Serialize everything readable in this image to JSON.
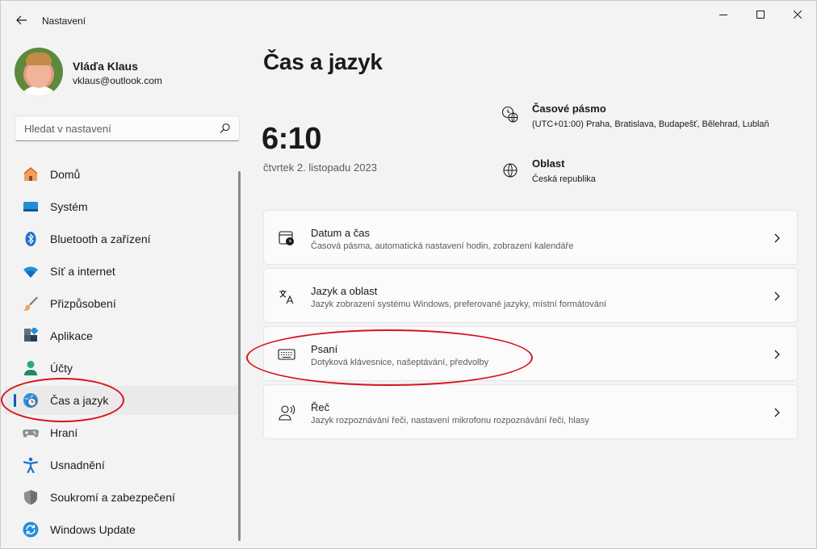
{
  "window": {
    "title": "Nastavení",
    "icons": {
      "back": "back-arrow-icon",
      "minimize": "minimize-icon",
      "maximize": "maximize-icon",
      "close": "close-icon"
    }
  },
  "profile": {
    "name": "Vláďa Klaus",
    "email": "vklaus@outlook.com"
  },
  "search": {
    "placeholder": "Hledat v nastavení",
    "icon": "search-icon"
  },
  "sidebar": {
    "items": [
      {
        "label": "Domů",
        "icon": "home-icon"
      },
      {
        "label": "Systém",
        "icon": "system-icon"
      },
      {
        "label": "Bluetooth a zařízení",
        "icon": "bluetooth-icon"
      },
      {
        "label": "Síť a internet",
        "icon": "wifi-icon"
      },
      {
        "label": "Přizpůsobení",
        "icon": "brush-icon"
      },
      {
        "label": "Aplikace",
        "icon": "apps-icon"
      },
      {
        "label": "Účty",
        "icon": "account-icon"
      },
      {
        "label": "Čas a jazyk",
        "icon": "time-language-icon",
        "active": true
      },
      {
        "label": "Hraní",
        "icon": "gamepad-icon"
      },
      {
        "label": "Usnadnění",
        "icon": "accessibility-icon"
      },
      {
        "label": "Soukromí a zabezpečení",
        "icon": "shield-icon"
      },
      {
        "label": "Windows Update",
        "icon": "update-icon"
      }
    ]
  },
  "main": {
    "title": "Čas a jazyk",
    "clock": "6:10",
    "date": "čtvrtek 2. listopadu 2023",
    "timezone": {
      "title": "Časové pásmo",
      "value": "(UTC+01:00) Praha, Bratislava, Budapešť, Bělehrad, Lublaň",
      "icon": "globe-clock-icon"
    },
    "region": {
      "title": "Oblast",
      "value": "Česká republika",
      "icon": "globe-icon"
    },
    "cards": [
      {
        "title": "Datum a čas",
        "subtitle": "Časová pásma, automatická nastavení hodin, zobrazení kalendáře",
        "icon": "calendar-clock-icon"
      },
      {
        "title": "Jazyk a oblast",
        "subtitle": "Jazyk zobrazení systému Windows, preferované jazyky, místní formátování",
        "icon": "language-icon"
      },
      {
        "title": "Psaní",
        "subtitle": "Dotyková klávesnice, našeptávání, předvolby",
        "icon": "keyboard-icon"
      },
      {
        "title": "Řeč",
        "subtitle": "Jazyk rozpoznávání řeči, nastavení mikrofonu rozpoznávání řeči, hlasy",
        "icon": "speech-icon"
      }
    ]
  },
  "colors": {
    "accent": "#005fb8",
    "annotation": "#d9121b"
  }
}
